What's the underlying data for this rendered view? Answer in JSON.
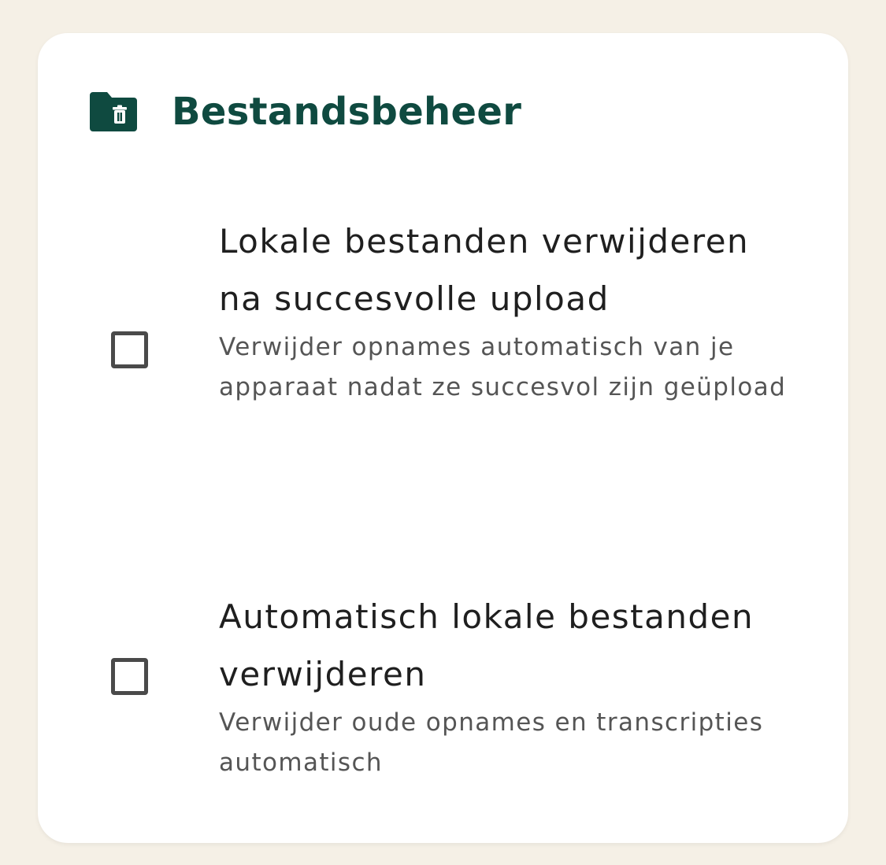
{
  "section": {
    "icon": "folder-delete-icon",
    "title": "Bestandsbeheer",
    "accent_color": "#0f4a40"
  },
  "options": [
    {
      "checked": false,
      "title": "Lokale bestanden verwijderen na succesvolle upload",
      "description": "Verwijder opnames automatisch van je apparaat nadat ze succesvol zijn geüpload"
    },
    {
      "checked": false,
      "title": "Automatisch lokale bestanden verwijderen",
      "description": "Verwijder oude opnames en transcripties automatisch"
    }
  ]
}
